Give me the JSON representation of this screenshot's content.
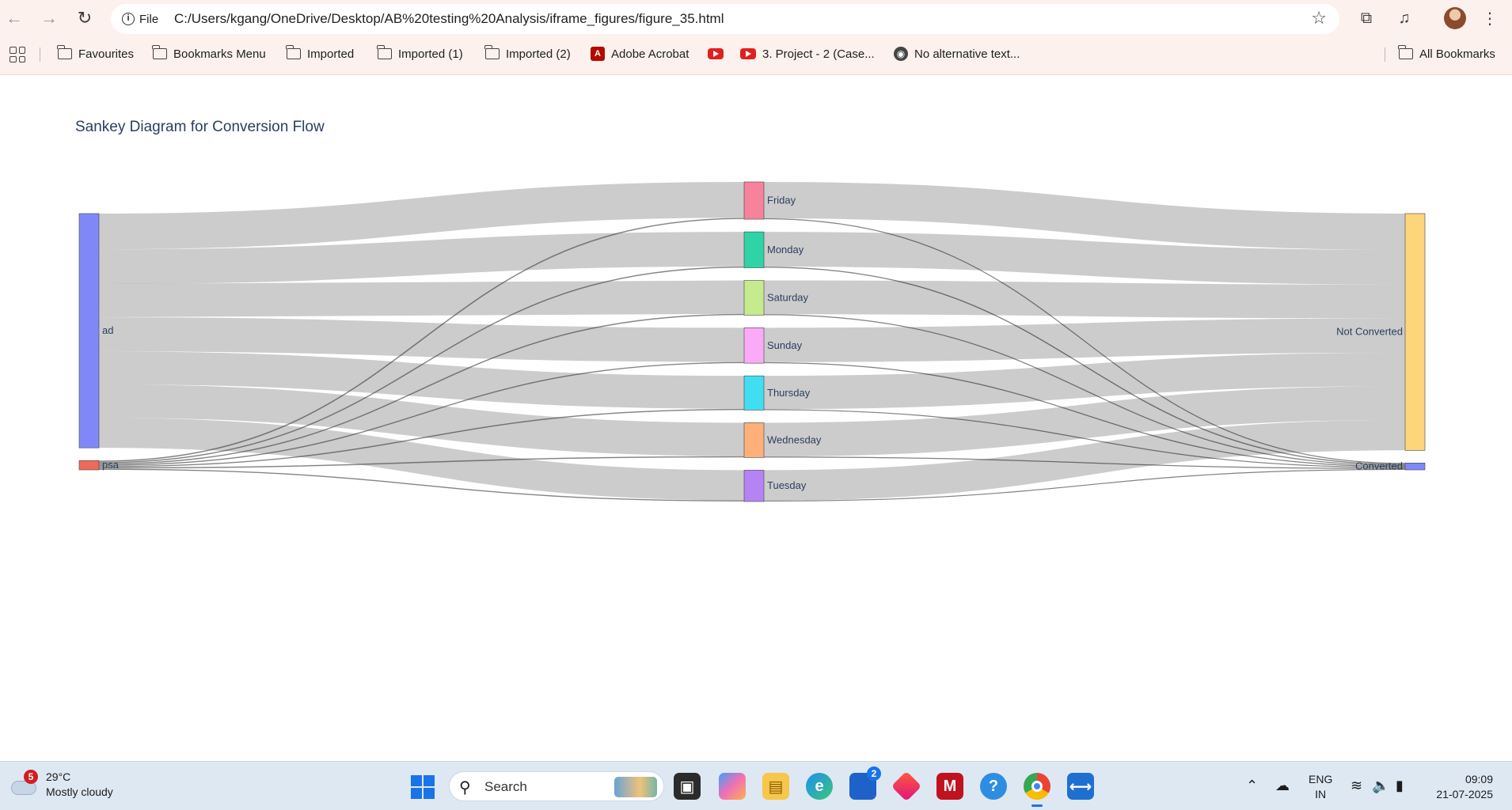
{
  "browser": {
    "site_chip": "File",
    "url": "C:/Users/kgang/OneDrive/Desktop/AB%20testing%20Analysis/iframe_figures/figure_35.html",
    "bookmarks": [
      {
        "label": "Favourites",
        "icon": "folder-icon"
      },
      {
        "label": "Bookmarks Menu",
        "icon": "folder-icon"
      },
      {
        "label": "Imported",
        "icon": "folder-icon"
      },
      {
        "label": "Imported (1)",
        "icon": "folder-icon"
      },
      {
        "label": "Imported (2)",
        "icon": "folder-icon"
      },
      {
        "label": "Adobe Acrobat",
        "icon": "adobe-acrobat-icon"
      },
      {
        "label": "",
        "icon": "youtube-icon"
      },
      {
        "label": "3. Project - 2 (Case...",
        "icon": "youtube-icon"
      },
      {
        "label": "No alternative text...",
        "icon": "globe-icon"
      }
    ],
    "all_bookmarks": "All Bookmarks"
  },
  "chart_data": {
    "type": "sankey",
    "title": "Sankey Diagram for Conversion Flow",
    "nodes": [
      {
        "label": "ad",
        "color": "#8088f8"
      },
      {
        "label": "psa",
        "color": "#ef6a59"
      },
      {
        "label": "Friday",
        "color": "#f6829c"
      },
      {
        "label": "Monday",
        "color": "#2ed3a6"
      },
      {
        "label": "Saturday",
        "color": "#c6ea8e"
      },
      {
        "label": "Sunday",
        "color": "#fbaaf8"
      },
      {
        "label": "Thursday",
        "color": "#41ddf1"
      },
      {
        "label": "Wednesday",
        "color": "#fdb07a"
      },
      {
        "label": "Tuesday",
        "color": "#b583f4"
      },
      {
        "label": "Not Converted",
        "color": "#fdd57a"
      },
      {
        "label": "Converted",
        "color": "#8088f8"
      }
    ],
    "links": [
      {
        "source": "ad",
        "target": "Friday",
        "value": 88
      },
      {
        "source": "ad",
        "target": "Monday",
        "value": 85
      },
      {
        "source": "ad",
        "target": "Saturday",
        "value": 82
      },
      {
        "source": "ad",
        "target": "Sunday",
        "value": 84
      },
      {
        "source": "ad",
        "target": "Thursday",
        "value": 81
      },
      {
        "source": "ad",
        "target": "Wednesday",
        "value": 82
      },
      {
        "source": "ad",
        "target": "Tuesday",
        "value": 74
      },
      {
        "source": "psa",
        "target": "Friday",
        "value": 3.6
      },
      {
        "source": "psa",
        "target": "Monday",
        "value": 3.3
      },
      {
        "source": "psa",
        "target": "Saturday",
        "value": 3.3
      },
      {
        "source": "psa",
        "target": "Sunday",
        "value": 3.1
      },
      {
        "source": "psa",
        "target": "Thursday",
        "value": 3.2
      },
      {
        "source": "psa",
        "target": "Wednesday",
        "value": 3.5
      },
      {
        "source": "psa",
        "target": "Tuesday",
        "value": 3.0
      },
      {
        "source": "Friday",
        "target": "Not Converted",
        "value": 89.4
      },
      {
        "source": "Friday",
        "target": "Converted",
        "value": 2.2
      },
      {
        "source": "Monday",
        "target": "Not Converted",
        "value": 85.3
      },
      {
        "source": "Monday",
        "target": "Converted",
        "value": 3.0
      },
      {
        "source": "Saturday",
        "target": "Not Converted",
        "value": 83.0
      },
      {
        "source": "Saturday",
        "target": "Converted",
        "value": 2.3
      },
      {
        "source": "Sunday",
        "target": "Not Converted",
        "value": 84.6
      },
      {
        "source": "Sunday",
        "target": "Converted",
        "value": 2.5
      },
      {
        "source": "Thursday",
        "target": "Not Converted",
        "value": 82.0
      },
      {
        "source": "Thursday",
        "target": "Converted",
        "value": 2.2
      },
      {
        "source": "Wednesday",
        "target": "Not Converted",
        "value": 83.0
      },
      {
        "source": "Wednesday",
        "target": "Converted",
        "value": 2.5
      },
      {
        "source": "Tuesday",
        "target": "Not Converted",
        "value": 74.8
      },
      {
        "source": "Tuesday",
        "target": "Converted",
        "value": 2.2
      }
    ]
  },
  "taskbar": {
    "weather_badge": "5",
    "temperature": "29°C",
    "weather_desc": "Mostly cloudy",
    "search_label": "Search",
    "store_badge": "2",
    "lang_top": "ENG",
    "lang_bottom": "IN",
    "time": "09:09",
    "date": "21-07-2025"
  }
}
